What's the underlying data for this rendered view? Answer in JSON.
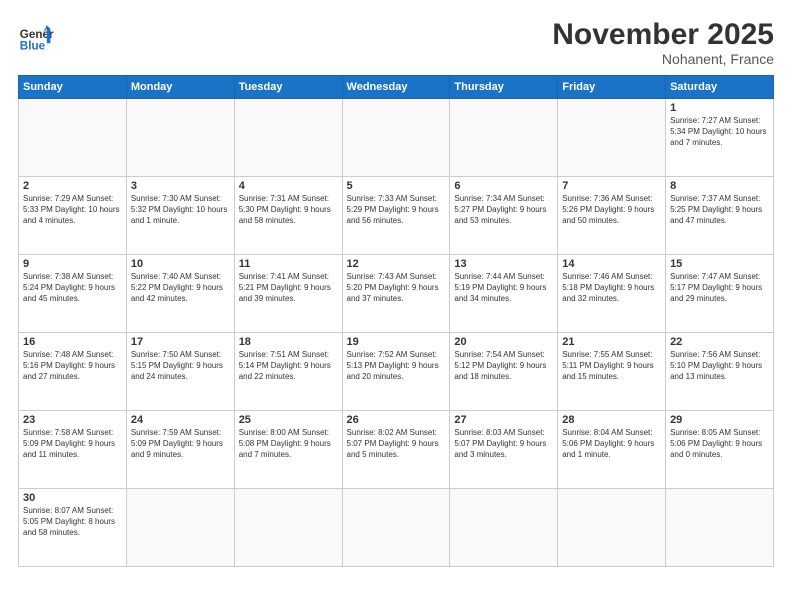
{
  "header": {
    "logo_general": "General",
    "logo_blue": "Blue",
    "month_title": "November 2025",
    "location": "Nohanent, France"
  },
  "days_of_week": [
    "Sunday",
    "Monday",
    "Tuesday",
    "Wednesday",
    "Thursday",
    "Friday",
    "Saturday"
  ],
  "weeks": [
    [
      {
        "day": "",
        "info": ""
      },
      {
        "day": "",
        "info": ""
      },
      {
        "day": "",
        "info": ""
      },
      {
        "day": "",
        "info": ""
      },
      {
        "day": "",
        "info": ""
      },
      {
        "day": "",
        "info": ""
      },
      {
        "day": "1",
        "info": "Sunrise: 7:27 AM\nSunset: 5:34 PM\nDaylight: 10 hours\nand 7 minutes."
      }
    ],
    [
      {
        "day": "2",
        "info": "Sunrise: 7:29 AM\nSunset: 5:33 PM\nDaylight: 10 hours\nand 4 minutes."
      },
      {
        "day": "3",
        "info": "Sunrise: 7:30 AM\nSunset: 5:32 PM\nDaylight: 10 hours\nand 1 minute."
      },
      {
        "day": "4",
        "info": "Sunrise: 7:31 AM\nSunset: 5:30 PM\nDaylight: 9 hours\nand 58 minutes."
      },
      {
        "day": "5",
        "info": "Sunrise: 7:33 AM\nSunset: 5:29 PM\nDaylight: 9 hours\nand 56 minutes."
      },
      {
        "day": "6",
        "info": "Sunrise: 7:34 AM\nSunset: 5:27 PM\nDaylight: 9 hours\nand 53 minutes."
      },
      {
        "day": "7",
        "info": "Sunrise: 7:36 AM\nSunset: 5:26 PM\nDaylight: 9 hours\nand 50 minutes."
      },
      {
        "day": "8",
        "info": "Sunrise: 7:37 AM\nSunset: 5:25 PM\nDaylight: 9 hours\nand 47 minutes."
      }
    ],
    [
      {
        "day": "9",
        "info": "Sunrise: 7:38 AM\nSunset: 5:24 PM\nDaylight: 9 hours\nand 45 minutes."
      },
      {
        "day": "10",
        "info": "Sunrise: 7:40 AM\nSunset: 5:22 PM\nDaylight: 9 hours\nand 42 minutes."
      },
      {
        "day": "11",
        "info": "Sunrise: 7:41 AM\nSunset: 5:21 PM\nDaylight: 9 hours\nand 39 minutes."
      },
      {
        "day": "12",
        "info": "Sunrise: 7:43 AM\nSunset: 5:20 PM\nDaylight: 9 hours\nand 37 minutes."
      },
      {
        "day": "13",
        "info": "Sunrise: 7:44 AM\nSunset: 5:19 PM\nDaylight: 9 hours\nand 34 minutes."
      },
      {
        "day": "14",
        "info": "Sunrise: 7:46 AM\nSunset: 5:18 PM\nDaylight: 9 hours\nand 32 minutes."
      },
      {
        "day": "15",
        "info": "Sunrise: 7:47 AM\nSunset: 5:17 PM\nDaylight: 9 hours\nand 29 minutes."
      }
    ],
    [
      {
        "day": "16",
        "info": "Sunrise: 7:48 AM\nSunset: 5:16 PM\nDaylight: 9 hours\nand 27 minutes."
      },
      {
        "day": "17",
        "info": "Sunrise: 7:50 AM\nSunset: 5:15 PM\nDaylight: 9 hours\nand 24 minutes."
      },
      {
        "day": "18",
        "info": "Sunrise: 7:51 AM\nSunset: 5:14 PM\nDaylight: 9 hours\nand 22 minutes."
      },
      {
        "day": "19",
        "info": "Sunrise: 7:52 AM\nSunset: 5:13 PM\nDaylight: 9 hours\nand 20 minutes."
      },
      {
        "day": "20",
        "info": "Sunrise: 7:54 AM\nSunset: 5:12 PM\nDaylight: 9 hours\nand 18 minutes."
      },
      {
        "day": "21",
        "info": "Sunrise: 7:55 AM\nSunset: 5:11 PM\nDaylight: 9 hours\nand 15 minutes."
      },
      {
        "day": "22",
        "info": "Sunrise: 7:56 AM\nSunset: 5:10 PM\nDaylight: 9 hours\nand 13 minutes."
      }
    ],
    [
      {
        "day": "23",
        "info": "Sunrise: 7:58 AM\nSunset: 5:09 PM\nDaylight: 9 hours\nand 11 minutes."
      },
      {
        "day": "24",
        "info": "Sunrise: 7:59 AM\nSunset: 5:09 PM\nDaylight: 9 hours\nand 9 minutes."
      },
      {
        "day": "25",
        "info": "Sunrise: 8:00 AM\nSunset: 5:08 PM\nDaylight: 9 hours\nand 7 minutes."
      },
      {
        "day": "26",
        "info": "Sunrise: 8:02 AM\nSunset: 5:07 PM\nDaylight: 9 hours\nand 5 minutes."
      },
      {
        "day": "27",
        "info": "Sunrise: 8:03 AM\nSunset: 5:07 PM\nDaylight: 9 hours\nand 3 minutes."
      },
      {
        "day": "28",
        "info": "Sunrise: 8:04 AM\nSunset: 5:06 PM\nDaylight: 9 hours\nand 1 minute."
      },
      {
        "day": "29",
        "info": "Sunrise: 8:05 AM\nSunset: 5:06 PM\nDaylight: 9 hours\nand 0 minutes."
      }
    ],
    [
      {
        "day": "30",
        "info": "Sunrise: 8:07 AM\nSunset: 5:05 PM\nDaylight: 8 hours\nand 58 minutes."
      },
      {
        "day": "",
        "info": ""
      },
      {
        "day": "",
        "info": ""
      },
      {
        "day": "",
        "info": ""
      },
      {
        "day": "",
        "info": ""
      },
      {
        "day": "",
        "info": ""
      },
      {
        "day": "",
        "info": ""
      }
    ]
  ]
}
